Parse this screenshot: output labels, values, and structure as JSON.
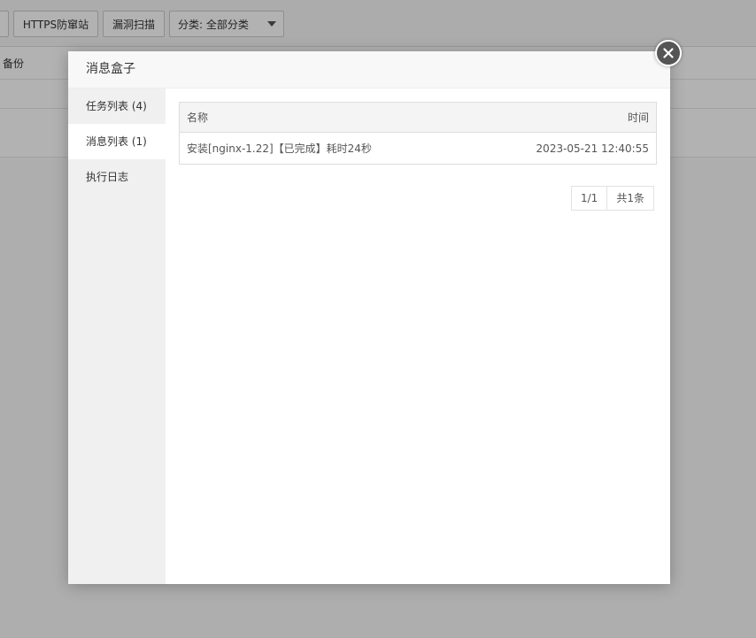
{
  "toolbar": {
    "https_btn": "HTTPS防窜站",
    "scan_btn": "漏洞扫描",
    "category_select": "分类: 全部分类"
  },
  "background_table": {
    "backup_header": "备份"
  },
  "modal": {
    "title": "消息盒子",
    "sidebar": [
      {
        "label": "任务列表 (4)"
      },
      {
        "label": "消息列表 (1)"
      },
      {
        "label": "执行日志"
      }
    ],
    "table": {
      "headers": {
        "name": "名称",
        "time": "时间"
      },
      "rows": [
        {
          "name": "安装[nginx-1.22]【已完成】耗时24秒",
          "time": "2023-05-21 12:40:55"
        }
      ]
    },
    "pagination": {
      "page": "1/1",
      "total": "共1条"
    }
  },
  "icons": {
    "close": "close-icon",
    "caret": "chevron-down-icon"
  }
}
